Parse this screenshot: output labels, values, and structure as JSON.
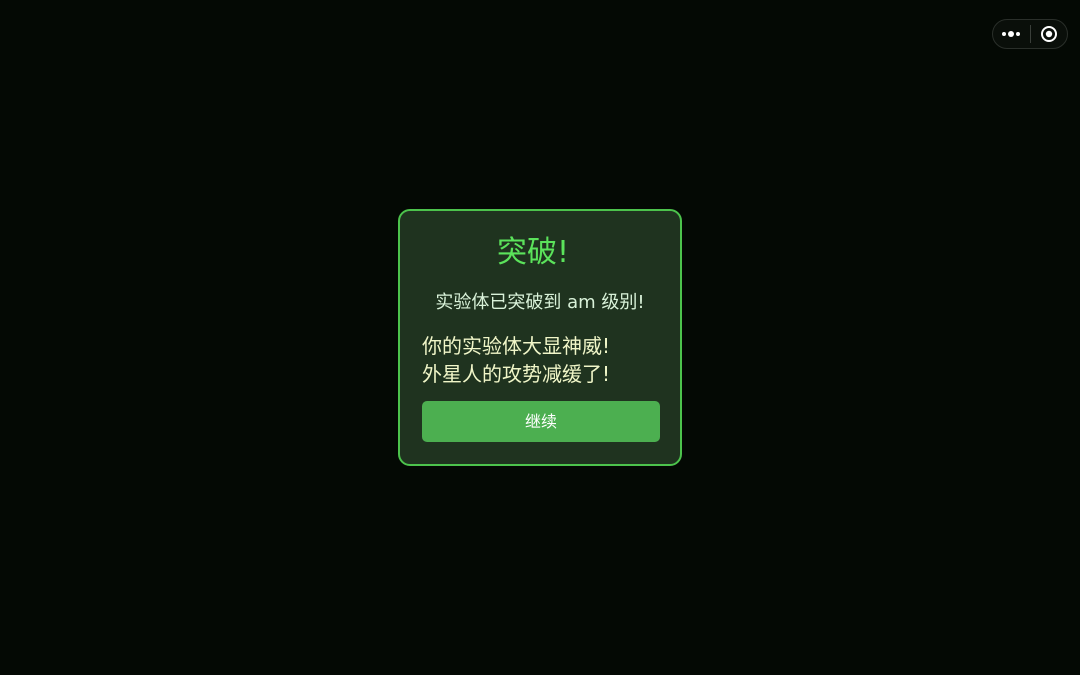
{
  "capsule": {
    "more_icon": "more-dots-icon",
    "close_icon": "target-close-icon"
  },
  "dialog": {
    "title": "突破!",
    "subtitle": "实验体已突破到 am 级别!",
    "message_lines": [
      "你的实验体大显神威!",
      "外星人的攻势减缓了!"
    ],
    "continue_label": "继续"
  },
  "colors": {
    "background": "#040904",
    "dialog_bg": "#1f331f",
    "dialog_border": "#4cc34c",
    "title": "#5be35b",
    "button": "#4caf50"
  }
}
